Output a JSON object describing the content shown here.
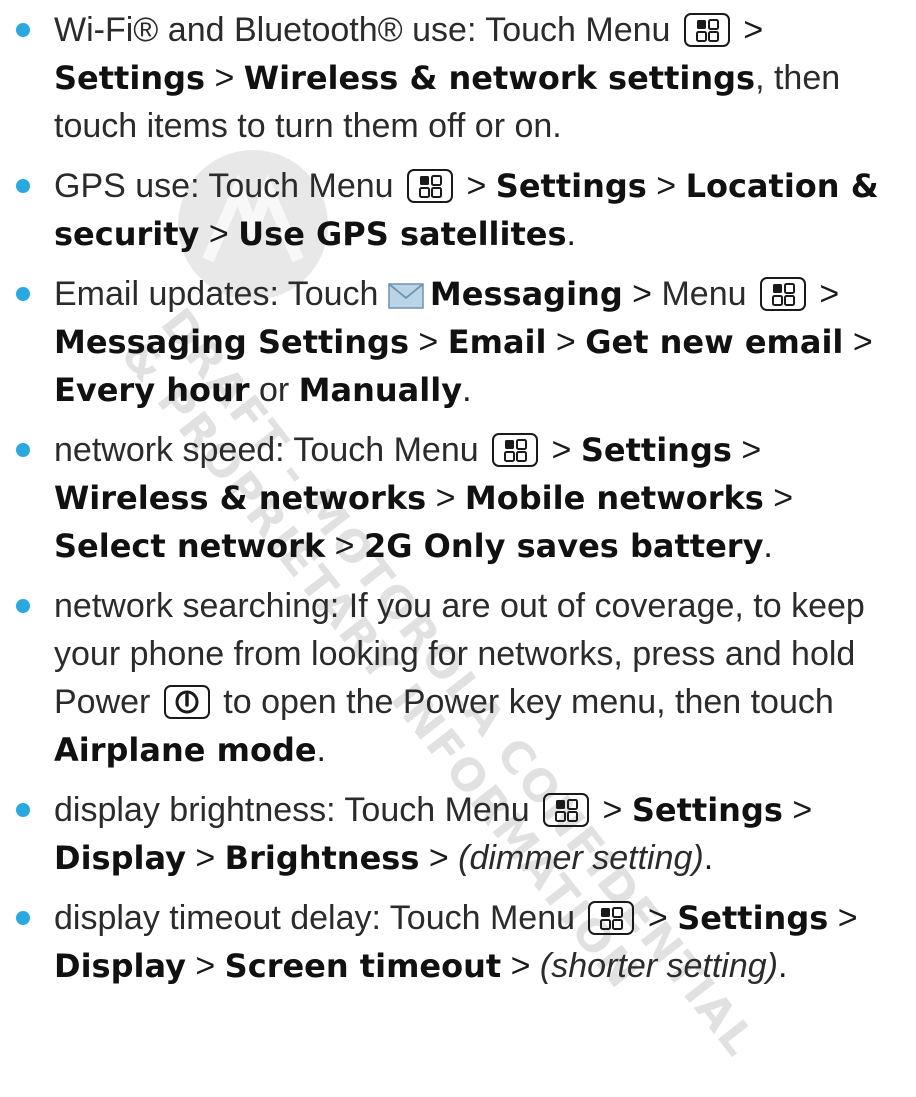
{
  "watermark": {
    "line1": "DRAFT - MOTOROLA CONFIDENTIAL",
    "line2": "& PROPRIETARY INFORMATION"
  },
  "tips": [
    {
      "lead": "Wi-Fi® and Bluetooth® use: Touch Menu",
      "s1": "Settings",
      "s2": "Wireless & network settings",
      "tail": ", then touch items to turn them off or on."
    },
    {
      "lead": "GPS use: Touch Menu",
      "s1": "Settings",
      "s2": "Location & security",
      "s3": "Use GPS satellites"
    },
    {
      "lead": "Email updates: Touch",
      "app": "Messaging",
      "menu": "Menu",
      "s1": "Messaging Settings",
      "s2": "Email",
      "s3": "Get new email",
      "s4": "Every hour",
      "or": "or",
      "s5": "Manually"
    },
    {
      "lead": "network speed: Touch Menu",
      "s1": "Settings",
      "s2": "Wireless & networks",
      "s3": "Mobile networks",
      "s4": "Select network",
      "s5": "2G Only saves battery"
    },
    {
      "lead": "network searching: If you are out of coverage, to keep your phone from looking for networks, press and hold Power",
      "mid": "to open the Power key menu, then touch",
      "s1": "Airplane mode"
    },
    {
      "lead": "display brightness: Touch Menu",
      "s1": "Settings",
      "s2": "Display",
      "s3": "Brightness",
      "setting": "(dimmer setting)"
    },
    {
      "lead": "display timeout delay: Touch Menu",
      "s1": "Settings",
      "s2": "Display",
      "s3": "Screen timeout",
      "setting": "(shorter setting)"
    }
  ],
  "icons": {
    "menu_key": "menu-key-icon",
    "power_key": "power-key-icon",
    "messaging": "envelope-icon",
    "bullet_color": "#2aa9e0"
  }
}
